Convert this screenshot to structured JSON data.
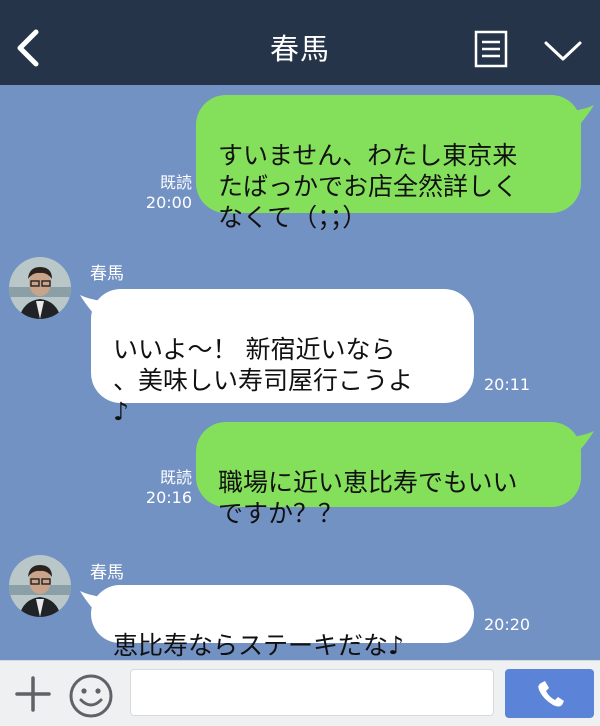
{
  "header": {
    "title": "春馬",
    "back_icon": "chevron-left-icon",
    "menu_icon": "note-icon",
    "dropdown_icon": "chevron-down-icon",
    "bg_color": "#263449"
  },
  "chat": {
    "bg_color": "#7392c4",
    "sent_bubble_color": "#84e05a",
    "recv_bubble_color": "#ffffff",
    "messages": [
      {
        "side": "sent",
        "text": "すいません、わたし東京来\nたばっかでお店全然詳しく\nなくて（；；）",
        "read": "既読",
        "time": "20:00"
      },
      {
        "side": "received",
        "sender": "春馬",
        "text": "いいよ〜！ 新宿近いなら\n、美味しい寿司屋行こうよ\n♪",
        "time": "20:11"
      },
      {
        "side": "sent",
        "text": "職場に近い恵比寿でもいい\nですか？？",
        "read": "既読",
        "time": "20:16"
      },
      {
        "side": "received",
        "sender": "春馬",
        "text": "恵比寿ならステーキだな♪",
        "time": "20:20"
      }
    ]
  },
  "footer": {
    "plus_icon": "plus-icon",
    "emoji_icon": "smiley-icon",
    "input_value": "",
    "call_icon": "phone-icon",
    "call_color": "#5b84d8"
  }
}
